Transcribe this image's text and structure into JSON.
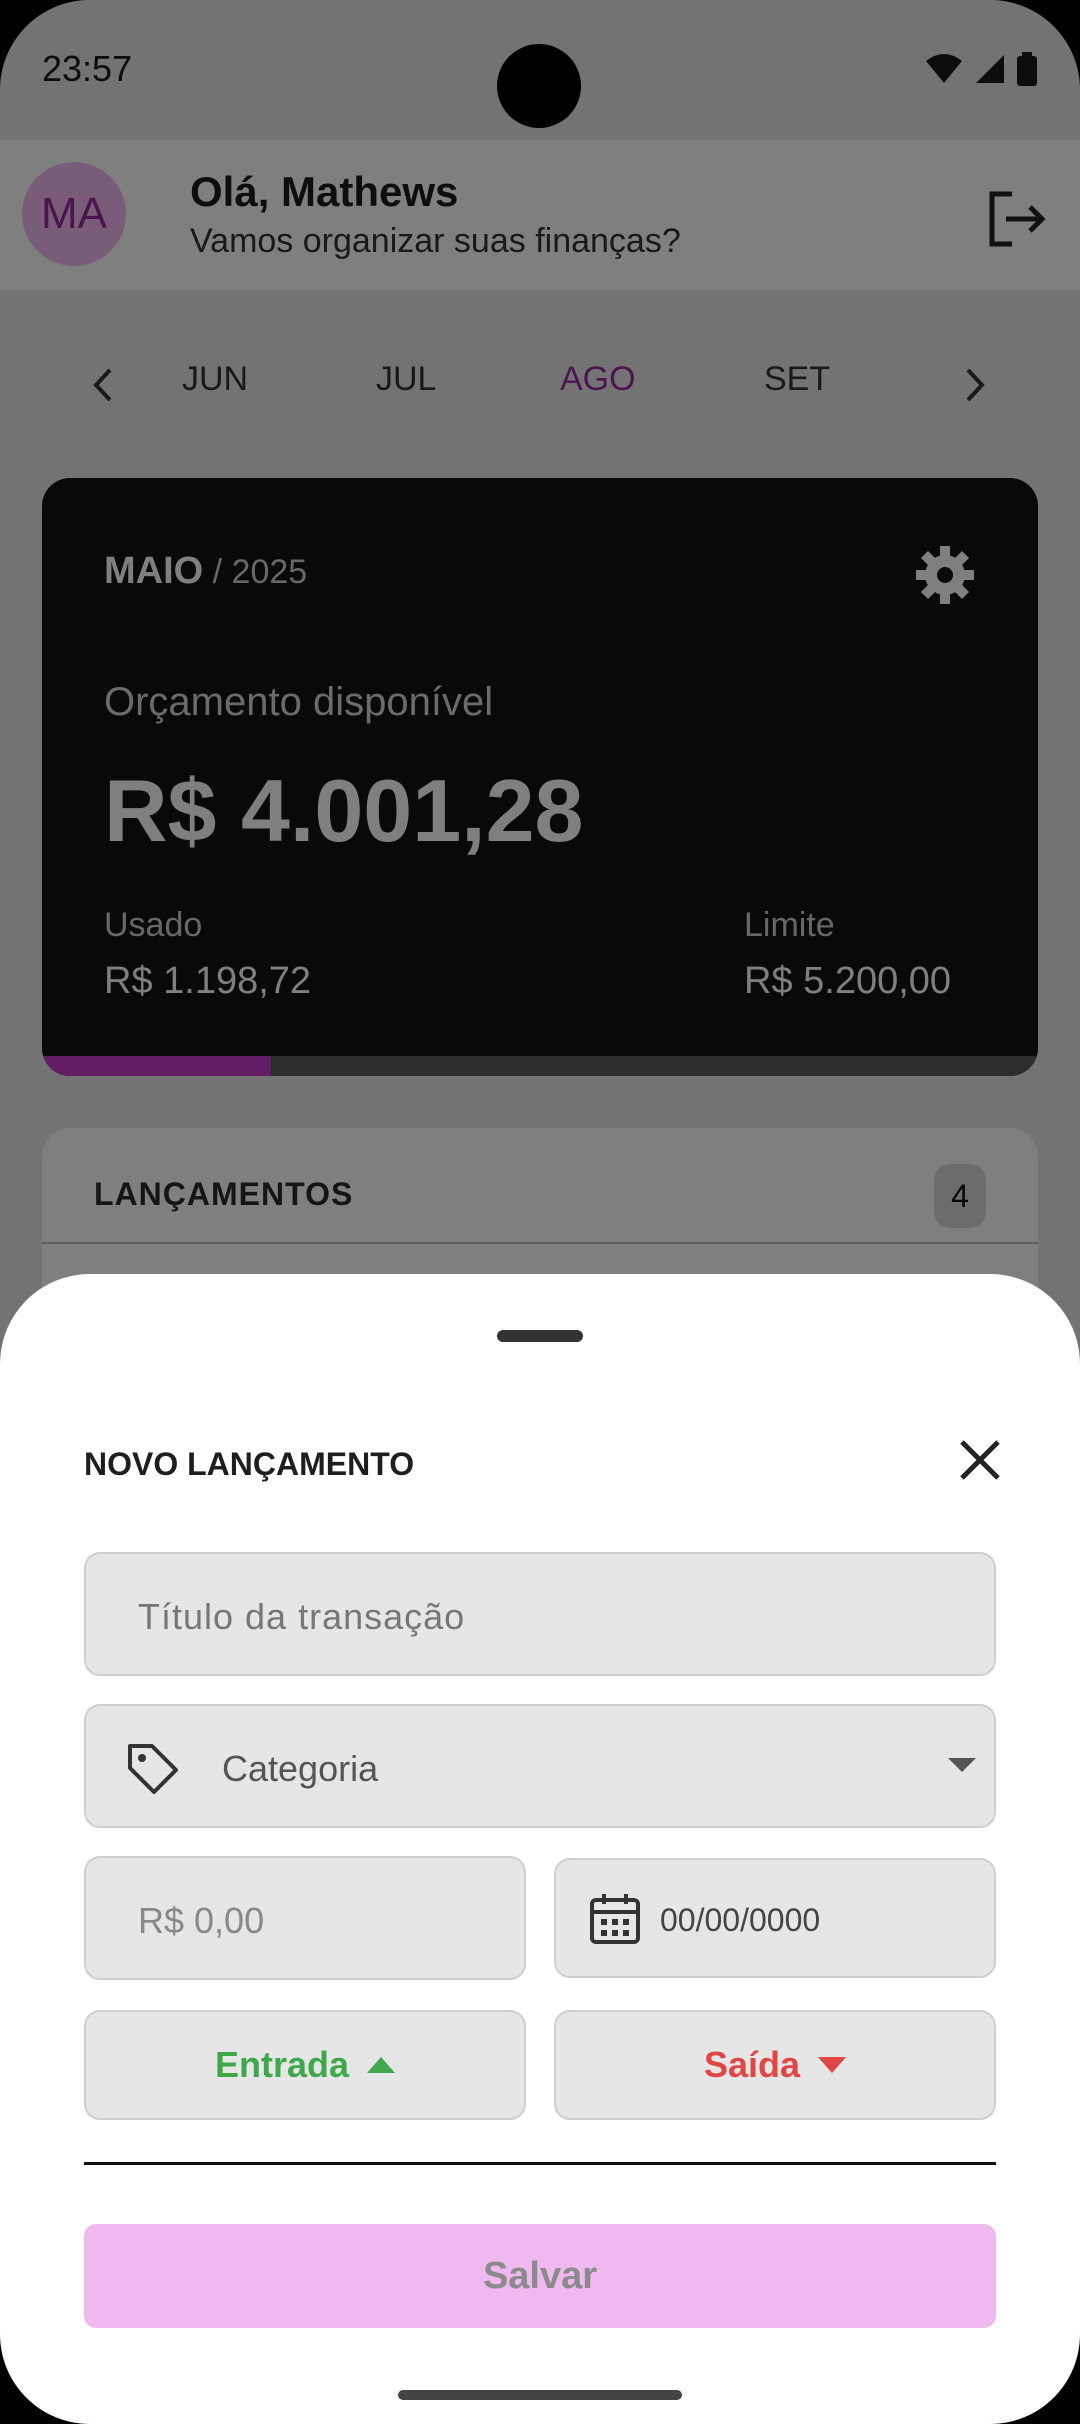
{
  "status": {
    "time": "23:57"
  },
  "header": {
    "avatar_initials": "MA",
    "greeting": "Olá, Mathews",
    "subtitle": "Vamos organizar suas finanças?"
  },
  "months": {
    "items": [
      "JUN",
      "JUL",
      "AGO",
      "SET"
    ],
    "active": "AGO"
  },
  "budget": {
    "month": "MAIO",
    "year_sep": " / 2025",
    "available_label": "Orçamento disponível",
    "available_value": "R$ 4.001,28",
    "used_label": "Usado",
    "used_value": "R$ 1.198,72",
    "limit_label": "Limite",
    "limit_value": "R$ 5.200,00",
    "progress_fraction": 0.23
  },
  "list": {
    "title": "LANÇAMENTOS",
    "count": "4"
  },
  "sheet": {
    "title": "NOVO LANÇAMENTO",
    "title_placeholder": "Título da transação",
    "category_placeholder": "Categoria",
    "amount_placeholder": "R$ 0,00",
    "date_placeholder": "00/00/0000",
    "income_label": "Entrada",
    "expense_label": "Saída",
    "save_label": "Salvar"
  },
  "colors": {
    "accent": "#9b2aa0",
    "income": "#3ea84a",
    "expense": "#e04646",
    "save_disabled": "#efb8ef"
  }
}
